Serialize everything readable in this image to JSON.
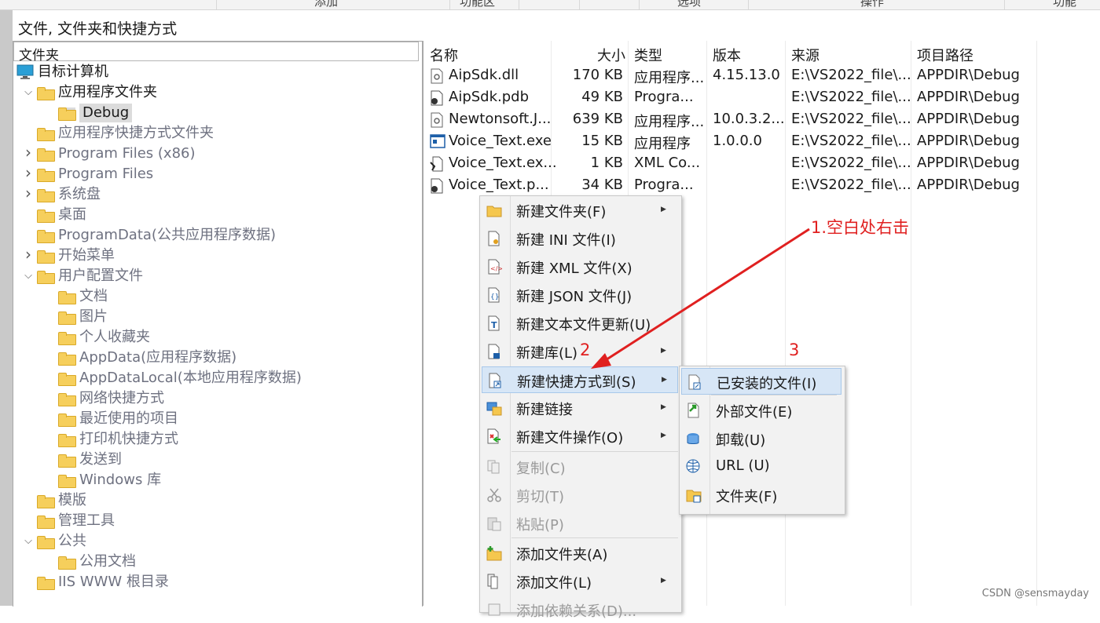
{
  "top_tabs": [
    "添加",
    "功能区",
    "选项",
    "操作",
    "功能"
  ],
  "section_title": "文件, 文件夹和快捷方式",
  "folder_panel": {
    "header": "文件夹",
    "tree": [
      {
        "label": "目标计算机",
        "depth": 0,
        "arrow": "",
        "icon": "computer",
        "gray": false
      },
      {
        "label": "应用程序文件夹",
        "depth": 1,
        "arrow": "expanded",
        "icon": "folder",
        "gray": false
      },
      {
        "label": "Debug",
        "depth": 2,
        "arrow": "",
        "icon": "folder",
        "gray": false,
        "selected": true
      },
      {
        "label": "应用程序快捷方式文件夹",
        "depth": 1,
        "arrow": "",
        "icon": "folder",
        "gray": true
      },
      {
        "label": "Program Files (x86)",
        "depth": 1,
        "arrow": "collapsed",
        "icon": "folder",
        "gray": true
      },
      {
        "label": "Program Files",
        "depth": 1,
        "arrow": "collapsed",
        "icon": "folder",
        "gray": true
      },
      {
        "label": "系统盘",
        "depth": 1,
        "arrow": "collapsed",
        "icon": "folder",
        "gray": true
      },
      {
        "label": "桌面",
        "depth": 1,
        "arrow": "",
        "icon": "folder",
        "gray": true
      },
      {
        "label": "ProgramData(公共应用程序数据)",
        "depth": 1,
        "arrow": "",
        "icon": "folder",
        "gray": true
      },
      {
        "label": "开始菜单",
        "depth": 1,
        "arrow": "collapsed",
        "icon": "folder",
        "gray": true
      },
      {
        "label": "用户配置文件",
        "depth": 1,
        "arrow": "expanded",
        "icon": "folder",
        "gray": true
      },
      {
        "label": "文档",
        "depth": 2,
        "arrow": "",
        "icon": "folder",
        "gray": true
      },
      {
        "label": "图片",
        "depth": 2,
        "arrow": "",
        "icon": "folder",
        "gray": true
      },
      {
        "label": "个人收藏夹",
        "depth": 2,
        "arrow": "",
        "icon": "folder",
        "gray": true
      },
      {
        "label": "AppData(应用程序数据)",
        "depth": 2,
        "arrow": "",
        "icon": "folder",
        "gray": true
      },
      {
        "label": "AppDataLocal(本地应用程序数据)",
        "depth": 2,
        "arrow": "",
        "icon": "folder",
        "gray": true
      },
      {
        "label": "网络快捷方式",
        "depth": 2,
        "arrow": "",
        "icon": "folder",
        "gray": true
      },
      {
        "label": "最近使用的项目",
        "depth": 2,
        "arrow": "",
        "icon": "folder",
        "gray": true
      },
      {
        "label": "打印机快捷方式",
        "depth": 2,
        "arrow": "",
        "icon": "folder",
        "gray": true
      },
      {
        "label": "发送到",
        "depth": 2,
        "arrow": "",
        "icon": "folder",
        "gray": true
      },
      {
        "label": "Windows 库",
        "depth": 2,
        "arrow": "",
        "icon": "folder",
        "gray": true
      },
      {
        "label": "模版",
        "depth": 1,
        "arrow": "",
        "icon": "folder",
        "gray": true
      },
      {
        "label": "管理工具",
        "depth": 1,
        "arrow": "",
        "icon": "folder",
        "gray": true
      },
      {
        "label": "公共",
        "depth": 1,
        "arrow": "expanded",
        "icon": "folder",
        "gray": true
      },
      {
        "label": "公用文档",
        "depth": 2,
        "arrow": "",
        "icon": "folder",
        "gray": true
      },
      {
        "label": "IIS WWW 根目录",
        "depth": 1,
        "arrow": "",
        "icon": "folder",
        "gray": true
      }
    ]
  },
  "file_list": {
    "columns": [
      "名称",
      "大小",
      "类型",
      "版本",
      "来源",
      "项目路径"
    ],
    "rows": [
      {
        "icon": "dll-icon",
        "name": "AipSdk.dll",
        "size": "170 KB",
        "type": "应用程序...",
        "version": "4.15.13.0",
        "source": "E:\\VS2022_file\\...",
        "path": "APPDIR\\Debug"
      },
      {
        "icon": "pdb-icon",
        "name": "AipSdk.pdb",
        "size": "49 KB",
        "type": "Progra...",
        "version": "",
        "source": "E:\\VS2022_file\\...",
        "path": "APPDIR\\Debug"
      },
      {
        "icon": "dll-icon",
        "name": "Newtonsoft.J...",
        "size": "639 KB",
        "type": "应用程序...",
        "version": "10.0.3.2...",
        "source": "E:\\VS2022_file\\...",
        "path": "APPDIR\\Debug"
      },
      {
        "icon": "exe-icon",
        "name": "Voice_Text.exe",
        "size": "15 KB",
        "type": "应用程序",
        "version": "1.0.0.0",
        "source": "E:\\VS2022_file\\...",
        "path": "APPDIR\\Debug"
      },
      {
        "icon": "config-icon",
        "name": "Voice_Text.ex...",
        "size": "1 KB",
        "type": "XML Co...",
        "version": "",
        "source": "E:\\VS2022_file\\...",
        "path": "APPDIR\\Debug"
      },
      {
        "icon": "pdb-icon",
        "name": "Voice_Text.p...",
        "size": "34 KB",
        "type": "Progra...",
        "version": "",
        "source": "E:\\VS2022_file\\...",
        "path": "APPDIR\\Debug"
      }
    ]
  },
  "context_menu": [
    {
      "label": "新建文件夹(F)",
      "icon": "new-folder-icon",
      "submenu": true,
      "disabled": false,
      "highlight": false
    },
    {
      "label": "新建 INI 文件(I)",
      "icon": "ini-file-icon",
      "submenu": false,
      "disabled": false,
      "highlight": false
    },
    {
      "label": "新建 XML 文件(X)",
      "icon": "xml-file-icon",
      "submenu": false,
      "disabled": false,
      "highlight": false
    },
    {
      "label": "新建 JSON 文件(J)",
      "icon": "json-file-icon",
      "submenu": false,
      "disabled": false,
      "highlight": false
    },
    {
      "label": "新建文本文件更新(U)",
      "icon": "text-file-icon",
      "submenu": false,
      "disabled": false,
      "highlight": false
    },
    {
      "label": "新建库(L)",
      "icon": "library-icon",
      "submenu": true,
      "disabled": false,
      "highlight": false
    },
    {
      "label": "新建快捷方式到(S)",
      "icon": "shortcut-icon",
      "submenu": true,
      "disabled": false,
      "highlight": true
    },
    {
      "label": "新建链接",
      "icon": "link-icon",
      "submenu": true,
      "disabled": false,
      "highlight": false
    },
    {
      "label": "新建文件操作(O)",
      "icon": "file-operation-icon",
      "submenu": true,
      "disabled": false,
      "highlight": false
    },
    {
      "label": "复制(C)",
      "icon": "copy-icon",
      "submenu": false,
      "disabled": true,
      "highlight": false
    },
    {
      "label": "剪切(T)",
      "icon": "cut-icon",
      "submenu": false,
      "disabled": true,
      "highlight": false
    },
    {
      "label": "粘贴(P)",
      "icon": "paste-icon",
      "submenu": false,
      "disabled": true,
      "highlight": false
    },
    {
      "label": "添加文件夹(A)",
      "icon": "add-folder-icon",
      "submenu": false,
      "disabled": false,
      "highlight": false
    },
    {
      "label": "添加文件(L)",
      "icon": "add-file-icon",
      "submenu": true,
      "disabled": false,
      "highlight": false
    },
    {
      "label": "添加依赖关系(D)...",
      "icon": "dependency-icon",
      "submenu": false,
      "disabled": true,
      "highlight": false
    }
  ],
  "submenu": [
    {
      "label": "已安装的文件(I)",
      "icon": "installed-file-icon",
      "highlight": true
    },
    {
      "label": "外部文件(E)",
      "icon": "external-file-icon",
      "highlight": false
    },
    {
      "label": "卸载(U)",
      "icon": "uninstall-icon",
      "highlight": false
    },
    {
      "label": "URL (U)",
      "icon": "url-icon",
      "highlight": false
    },
    {
      "label": "文件夹(F)",
      "icon": "folder-shortcut-icon",
      "highlight": false
    }
  ],
  "annotations": {
    "step1": "1.空白处右击",
    "step2": "2",
    "step3": "3",
    "color": "#e02020"
  },
  "watermark": "CSDN @sensmayday"
}
